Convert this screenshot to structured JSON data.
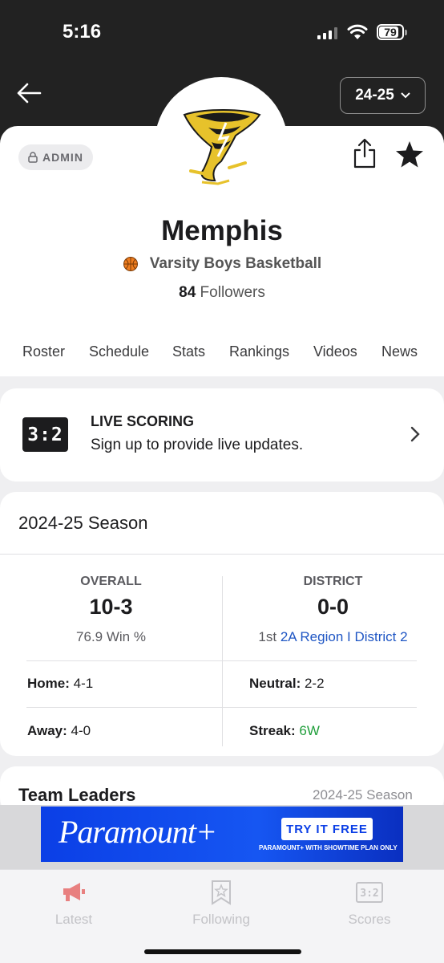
{
  "status_bar": {
    "time": "5:16",
    "battery": "79"
  },
  "header": {
    "season_selector": "24-25",
    "admin_badge": "ADMIN"
  },
  "team": {
    "name": "Memphis",
    "subtitle": "Varsity Boys Basketball",
    "followers_count": "84",
    "followers_label": "Followers"
  },
  "tabs": [
    "Roster",
    "Schedule",
    "Stats",
    "Rankings",
    "Videos",
    "News"
  ],
  "live_scoring": {
    "icon_text": "3:2",
    "title": "LIVE SCORING",
    "description": "Sign up to provide live updates."
  },
  "season": {
    "title": "2024-25 Season",
    "overall": {
      "label": "OVERALL",
      "record": "10-3",
      "win_pct": "76.9 Win %"
    },
    "district": {
      "label": "DISTRICT",
      "record": "0-0",
      "rank": "1st",
      "district_name": "2A Region I District 2"
    },
    "home": {
      "label": "Home:",
      "value": "4-1"
    },
    "neutral": {
      "label": "Neutral:",
      "value": "2-2"
    },
    "away": {
      "label": "Away:",
      "value": "4-0"
    },
    "streak": {
      "label": "Streak:",
      "value": "6W"
    }
  },
  "team_leaders": {
    "title": "Team Leaders",
    "season": "2024-25 Season"
  },
  "ad": {
    "brand": "Paramount+",
    "cta": "TRY IT FREE",
    "fine_print": "PARAMOUNT+ WITH SHOWTIME PLAN ONLY"
  },
  "bottom_nav": [
    {
      "label": "Latest",
      "icon": "megaphone-icon"
    },
    {
      "label": "Following",
      "icon": "bookmark-star-icon"
    },
    {
      "label": "Scores",
      "icon": "scoreboard-icon"
    }
  ],
  "colors": {
    "accent_link": "#1f56c4",
    "streak_green": "#1f9e3a",
    "latest_icon": "#e88080"
  }
}
